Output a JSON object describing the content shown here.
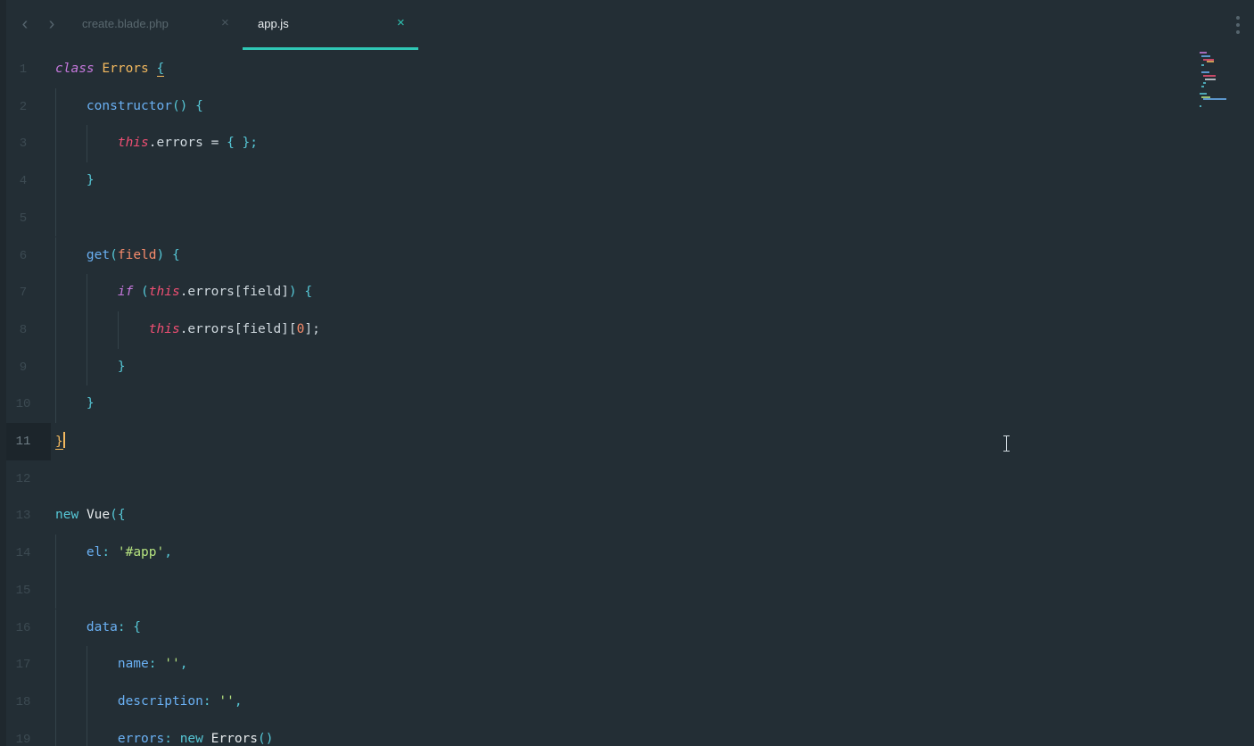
{
  "tabs": [
    {
      "label": "create.blade.php",
      "close": "×",
      "active": false
    },
    {
      "label": "app.js",
      "close": "×",
      "active": true
    }
  ],
  "nav": {
    "back": "‹",
    "forward": "›"
  },
  "colors": {
    "background": "#232e35",
    "accent": "#2fc7b5",
    "keyword": "#c678dd",
    "class_name": "#f3b95f",
    "function": "#6ab0f3",
    "this": "#ef4f73",
    "string": "#b5e27f",
    "number": "#f78c6c"
  },
  "editor": {
    "current_line": 11,
    "lines": [
      {
        "n": "1"
      },
      {
        "n": "2"
      },
      {
        "n": "3"
      },
      {
        "n": "4"
      },
      {
        "n": "5"
      },
      {
        "n": "6"
      },
      {
        "n": "7"
      },
      {
        "n": "8"
      },
      {
        "n": "9"
      },
      {
        "n": "10"
      },
      {
        "n": "11"
      },
      {
        "n": "12"
      },
      {
        "n": "13"
      },
      {
        "n": "14"
      },
      {
        "n": "15"
      },
      {
        "n": "16"
      },
      {
        "n": "17"
      },
      {
        "n": "18"
      },
      {
        "n": "19"
      }
    ],
    "tokens": {
      "l1": {
        "a": "class",
        "b": "Errors",
        "c": "{"
      },
      "l2": {
        "a": "constructor",
        "b": "() {"
      },
      "l3": {
        "a": "this",
        "b": ".errors = ",
        "c": "{ };"
      },
      "l4": {
        "a": "}"
      },
      "l6": {
        "a": "get",
        "b": "(",
        "c": "field",
        "d": ") {"
      },
      "l7": {
        "a": "if",
        "b": " (",
        "c": "this",
        "d": ".errors[field]",
        "e": ") {"
      },
      "l8": {
        "a": "this",
        "b": ".errors[field][",
        "c": "0",
        "d": "];"
      },
      "l9": {
        "a": "}"
      },
      "l10": {
        "a": "}"
      },
      "l11": {
        "a": "}"
      },
      "l13": {
        "a": "new",
        "b": "Vue",
        "c": "({"
      },
      "l14": {
        "a": "el",
        "b": ": ",
        "c": "'#app'",
        "d": ","
      },
      "l16": {
        "a": "data",
        "b": ": {"
      },
      "l17": {
        "a": "name",
        "b": ": ",
        "c": "''",
        "d": ","
      },
      "l18": {
        "a": "description",
        "b": ": ",
        "c": "''",
        "d": ","
      },
      "l19": {
        "a": "errors",
        "b": ": ",
        "c": "new",
        "d": "Errors",
        "e": "()"
      }
    }
  }
}
